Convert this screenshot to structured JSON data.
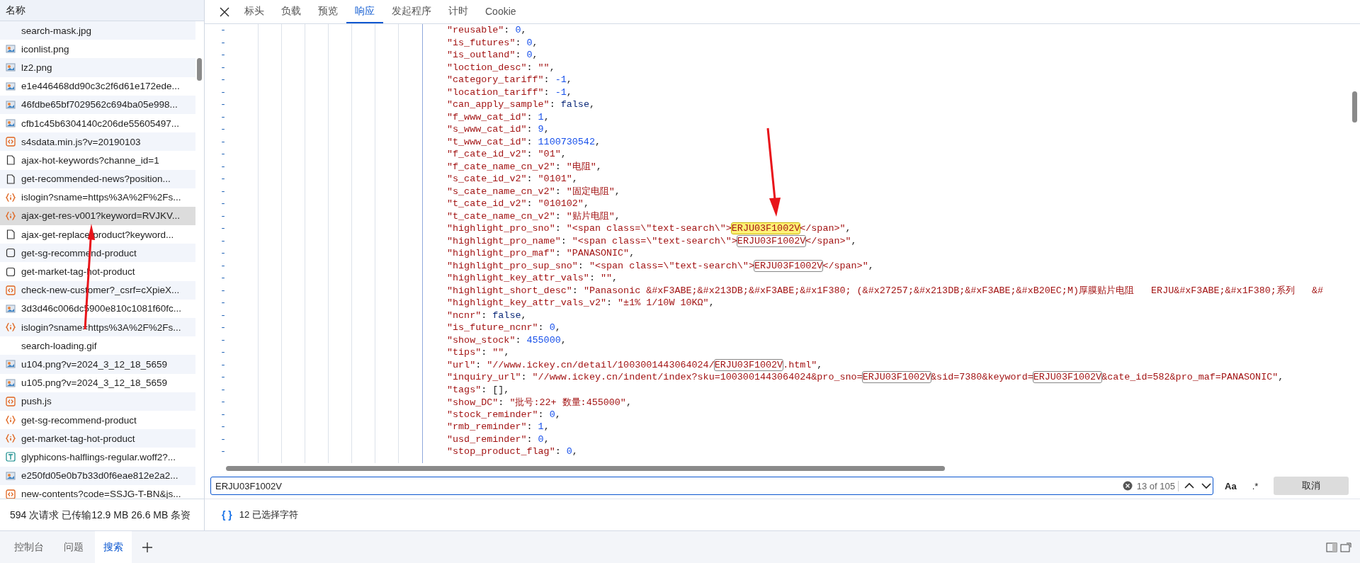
{
  "request_list": {
    "header": "名称",
    "items": [
      {
        "name": "search-mask.jpg",
        "kind": "none",
        "selected": false
      },
      {
        "name": "iconlist.png",
        "kind": "image",
        "selected": false
      },
      {
        "name": "lz2.png",
        "kind": "image",
        "selected": false
      },
      {
        "name": "e1e446468dd90c3c2f6d61e172ede...",
        "kind": "image",
        "selected": false
      },
      {
        "name": "46fdbe65bf7029562c694ba05e998...",
        "kind": "image",
        "selected": false
      },
      {
        "name": "cfb1c45b6304140c206de55605497...",
        "kind": "image",
        "selected": false
      },
      {
        "name": "s4sdata.min.js?v=20190103",
        "kind": "script",
        "selected": false
      },
      {
        "name": "ajax-hot-keywords?channe_id=1",
        "kind": "doc",
        "selected": false
      },
      {
        "name": "get-recommended-news?position...",
        "kind": "doc",
        "selected": false
      },
      {
        "name": "islogin?sname=https%3A%2F%2Fs...",
        "kind": "fetch",
        "selected": false
      },
      {
        "name": "ajax-get-res-v001?keyword=RVJKV...",
        "kind": "fetch",
        "selected": true
      },
      {
        "name": "ajax-get-replace-product?keyword...",
        "kind": "doc",
        "selected": false
      },
      {
        "name": "get-sg-recommend-product",
        "kind": "other",
        "selected": false
      },
      {
        "name": "get-market-tag-hot-product",
        "kind": "other",
        "selected": false
      },
      {
        "name": "check-new-customer?_csrf=cXpieX...",
        "kind": "script",
        "selected": false
      },
      {
        "name": "3d3d46c006dc5900e810c1081f60fc...",
        "kind": "image",
        "selected": false
      },
      {
        "name": "islogin?sname=https%3A%2F%2Fs...",
        "kind": "fetch",
        "selected": false
      },
      {
        "name": "search-loading.gif",
        "kind": "none",
        "selected": false
      },
      {
        "name": "u104.png?v=2024_3_12_18_5659",
        "kind": "image",
        "selected": false
      },
      {
        "name": "u105.png?v=2024_3_12_18_5659",
        "kind": "image",
        "selected": false
      },
      {
        "name": "push.js",
        "kind": "script",
        "selected": false
      },
      {
        "name": "get-sg-recommend-product",
        "kind": "fetch",
        "selected": false
      },
      {
        "name": "get-market-tag-hot-product",
        "kind": "fetch",
        "selected": false
      },
      {
        "name": "glyphicons-halflings-regular.woff2?...",
        "kind": "font",
        "selected": false
      },
      {
        "name": "e250fd05e0b7b33d0f6eae812e2a2...",
        "kind": "image",
        "selected": false
      },
      {
        "name": "new-contents?code=SSJG-T-BN&js...",
        "kind": "script",
        "selected": false
      }
    ]
  },
  "request_status": "594 次请求  已传输12.9 MB  26.6 MB 条资",
  "detail_tabs": [
    {
      "label": "标头",
      "selected": false
    },
    {
      "label": "负载",
      "selected": false
    },
    {
      "label": "预览",
      "selected": false
    },
    {
      "label": "响应",
      "selected": true
    },
    {
      "label": "发起程序",
      "selected": false
    },
    {
      "label": "计时",
      "selected": false
    },
    {
      "label": "Cookie",
      "selected": false
    }
  ],
  "code_lines": [
    {
      "marker": "-",
      "segments": [
        {
          "text": "\"reusable\"",
          "kind": "key"
        },
        {
          "text": ": ",
          "kind": "p"
        },
        {
          "text": "0",
          "kind": "num"
        },
        {
          "text": ",",
          "kind": "p"
        }
      ]
    },
    {
      "marker": "-",
      "segments": [
        {
          "text": "\"is_futures\"",
          "kind": "key"
        },
        {
          "text": ": ",
          "kind": "p"
        },
        {
          "text": "0",
          "kind": "num"
        },
        {
          "text": ",",
          "kind": "p"
        }
      ]
    },
    {
      "marker": "-",
      "segments": [
        {
          "text": "\"is_outland\"",
          "kind": "key"
        },
        {
          "text": ": ",
          "kind": "p"
        },
        {
          "text": "0",
          "kind": "num"
        },
        {
          "text": ",",
          "kind": "p"
        }
      ]
    },
    {
      "marker": "-",
      "segments": [
        {
          "text": "\"loction_desc\"",
          "kind": "key"
        },
        {
          "text": ": ",
          "kind": "p"
        },
        {
          "text": "\"\"",
          "kind": "str"
        },
        {
          "text": ",",
          "kind": "p"
        }
      ]
    },
    {
      "marker": "-",
      "segments": [
        {
          "text": "\"category_tariff\"",
          "kind": "key"
        },
        {
          "text": ": ",
          "kind": "p"
        },
        {
          "text": "-1",
          "kind": "num"
        },
        {
          "text": ",",
          "kind": "p"
        }
      ]
    },
    {
      "marker": "-",
      "segments": [
        {
          "text": "\"location_tariff\"",
          "kind": "key"
        },
        {
          "text": ": ",
          "kind": "p"
        },
        {
          "text": "-1",
          "kind": "num"
        },
        {
          "text": ",",
          "kind": "p"
        }
      ]
    },
    {
      "marker": "-",
      "segments": [
        {
          "text": "\"can_apply_sample\"",
          "kind": "key"
        },
        {
          "text": ": ",
          "kind": "p"
        },
        {
          "text": "false",
          "kind": "kw"
        },
        {
          "text": ",",
          "kind": "p"
        }
      ]
    },
    {
      "marker": "-",
      "segments": [
        {
          "text": "\"f_www_cat_id\"",
          "kind": "key"
        },
        {
          "text": ": ",
          "kind": "p"
        },
        {
          "text": "1",
          "kind": "num"
        },
        {
          "text": ",",
          "kind": "p"
        }
      ]
    },
    {
      "marker": "-",
      "segments": [
        {
          "text": "\"s_www_cat_id\"",
          "kind": "key"
        },
        {
          "text": ": ",
          "kind": "p"
        },
        {
          "text": "9",
          "kind": "num"
        },
        {
          "text": ",",
          "kind": "p"
        }
      ]
    },
    {
      "marker": "-",
      "segments": [
        {
          "text": "\"t_www_cat_id\"",
          "kind": "key"
        },
        {
          "text": ": ",
          "kind": "p"
        },
        {
          "text": "1100730542",
          "kind": "num"
        },
        {
          "text": ",",
          "kind": "p"
        }
      ]
    },
    {
      "marker": "-",
      "segments": [
        {
          "text": "\"f_cate_id_v2\"",
          "kind": "key"
        },
        {
          "text": ": ",
          "kind": "p"
        },
        {
          "text": "\"01\"",
          "kind": "str"
        },
        {
          "text": ",",
          "kind": "p"
        }
      ]
    },
    {
      "marker": "-",
      "segments": [
        {
          "text": "\"f_cate_name_cn_v2\"",
          "kind": "key"
        },
        {
          "text": ": ",
          "kind": "p"
        },
        {
          "text": "\"电阻\"",
          "kind": "str"
        },
        {
          "text": ",",
          "kind": "p"
        }
      ]
    },
    {
      "marker": "-",
      "segments": [
        {
          "text": "\"s_cate_id_v2\"",
          "kind": "key"
        },
        {
          "text": ": ",
          "kind": "p"
        },
        {
          "text": "\"0101\"",
          "kind": "str"
        },
        {
          "text": ",",
          "kind": "p"
        }
      ]
    },
    {
      "marker": "-",
      "segments": [
        {
          "text": "\"s_cate_name_cn_v2\"",
          "kind": "key"
        },
        {
          "text": ": ",
          "kind": "p"
        },
        {
          "text": "\"固定电阻\"",
          "kind": "str"
        },
        {
          "text": ",",
          "kind": "p"
        }
      ]
    },
    {
      "marker": "-",
      "segments": [
        {
          "text": "\"t_cate_id_v2\"",
          "kind": "key"
        },
        {
          "text": ": ",
          "kind": "p"
        },
        {
          "text": "\"010102\"",
          "kind": "str"
        },
        {
          "text": ",",
          "kind": "p"
        }
      ]
    },
    {
      "marker": "-",
      "segments": [
        {
          "text": "\"t_cate_name_cn_v2\"",
          "kind": "key"
        },
        {
          "text": ": ",
          "kind": "p"
        },
        {
          "text": "\"贴片电阻\"",
          "kind": "str"
        },
        {
          "text": ",",
          "kind": "p"
        }
      ]
    },
    {
      "marker": "-",
      "segments": [
        {
          "text": "\"highlight_pro_sno\"",
          "kind": "key"
        },
        {
          "text": ": ",
          "kind": "p"
        },
        {
          "text": "\"<span class=\\\"text-search\\\">",
          "kind": "str"
        },
        {
          "text": "ERJU03F1002V",
          "kind": "current"
        },
        {
          "text": "</span>\"",
          "kind": "str"
        },
        {
          "text": ",",
          "kind": "p"
        }
      ]
    },
    {
      "marker": "-",
      "segments": [
        {
          "text": "\"highlight_pro_name\"",
          "kind": "key"
        },
        {
          "text": ": ",
          "kind": "p"
        },
        {
          "text": "\"<span class=\\\"text-search\\\">",
          "kind": "str"
        },
        {
          "text": "ERJU03F1002V",
          "kind": "match"
        },
        {
          "text": "</span>\"",
          "kind": "str"
        },
        {
          "text": ",",
          "kind": "p"
        }
      ]
    },
    {
      "marker": "-",
      "segments": [
        {
          "text": "\"highlight_pro_maf\"",
          "kind": "key"
        },
        {
          "text": ": ",
          "kind": "p"
        },
        {
          "text": "\"PANASONIC\"",
          "kind": "str"
        },
        {
          "text": ",",
          "kind": "p"
        }
      ]
    },
    {
      "marker": "-",
      "segments": [
        {
          "text": "\"highlight_pro_sup_sno\"",
          "kind": "key"
        },
        {
          "text": ": ",
          "kind": "p"
        },
        {
          "text": "\"<span class=\\\"text-search\\\">",
          "kind": "str"
        },
        {
          "text": "ERJU03F1002V",
          "kind": "match"
        },
        {
          "text": "</span>\"",
          "kind": "str"
        },
        {
          "text": ",",
          "kind": "p"
        }
      ]
    },
    {
      "marker": "-",
      "segments": [
        {
          "text": "\"highlight_key_attr_vals\"",
          "kind": "key"
        },
        {
          "text": ": ",
          "kind": "p"
        },
        {
          "text": "\"\"",
          "kind": "str"
        },
        {
          "text": ",",
          "kind": "p"
        }
      ]
    },
    {
      "marker": "-",
      "segments": [
        {
          "text": "\"highlight_short_desc\"",
          "kind": "key"
        },
        {
          "text": ": ",
          "kind": "p"
        },
        {
          "text": "\"Panasonic &#xF3ABE;&#x213DB;&#xF3ABE;&#x1F380; (&#x27257;&#x213DB;&#xF3ABE;&#xB20EC;M)厚膜贴片电阻   ERJU&#xF3ABE;&#x1F380;系列   &#",
          "kind": "str"
        }
      ]
    },
    {
      "marker": "-",
      "segments": [
        {
          "text": "\"highlight_key_attr_vals_v2\"",
          "kind": "key"
        },
        {
          "text": ": ",
          "kind": "p"
        },
        {
          "text": "\"±1% 1/10W 10KΩ\"",
          "kind": "str"
        },
        {
          "text": ",",
          "kind": "p"
        }
      ]
    },
    {
      "marker": "-",
      "segments": [
        {
          "text": "\"ncnr\"",
          "kind": "key"
        },
        {
          "text": ": ",
          "kind": "p"
        },
        {
          "text": "false",
          "kind": "kw"
        },
        {
          "text": ",",
          "kind": "p"
        }
      ]
    },
    {
      "marker": "-",
      "segments": [
        {
          "text": "\"is_future_ncnr\"",
          "kind": "key"
        },
        {
          "text": ": ",
          "kind": "p"
        },
        {
          "text": "0",
          "kind": "num"
        },
        {
          "text": ",",
          "kind": "p"
        }
      ]
    },
    {
      "marker": "-",
      "segments": [
        {
          "text": "\"show_stock\"",
          "kind": "key"
        },
        {
          "text": ": ",
          "kind": "p"
        },
        {
          "text": "455000",
          "kind": "num"
        },
        {
          "text": ",",
          "kind": "p"
        }
      ]
    },
    {
      "marker": "-",
      "segments": [
        {
          "text": "\"tips\"",
          "kind": "key"
        },
        {
          "text": ": ",
          "kind": "p"
        },
        {
          "text": "\"\"",
          "kind": "str"
        },
        {
          "text": ",",
          "kind": "p"
        }
      ]
    },
    {
      "marker": "-",
      "segments": [
        {
          "text": "\"url\"",
          "kind": "key"
        },
        {
          "text": ": ",
          "kind": "p"
        },
        {
          "text": "\"//www.ickey.cn/detail/1003001443064024/",
          "kind": "str"
        },
        {
          "text": "ERJU03F1002V",
          "kind": "match"
        },
        {
          "text": ".html\"",
          "kind": "str"
        },
        {
          "text": ",",
          "kind": "p"
        }
      ]
    },
    {
      "marker": "-",
      "segments": [
        {
          "text": "\"inquiry_url\"",
          "kind": "key"
        },
        {
          "text": ": ",
          "kind": "p"
        },
        {
          "text": "\"//www.ickey.cn/indent/index?sku=1003001443064024&pro_sno=",
          "kind": "str"
        },
        {
          "text": "ERJU03F1002V",
          "kind": "match"
        },
        {
          "text": "&sid=7380&keyword=",
          "kind": "str"
        },
        {
          "text": "ERJU03F1002V",
          "kind": "match"
        },
        {
          "text": "&cate_id=582&pro_maf=PANASONIC\"",
          "kind": "str"
        },
        {
          "text": ",",
          "kind": "p"
        }
      ]
    },
    {
      "marker": "-",
      "segments": [
        {
          "text": "\"tags\"",
          "kind": "key"
        },
        {
          "text": ": [],",
          "kind": "p"
        }
      ]
    },
    {
      "marker": "-",
      "segments": [
        {
          "text": "\"show_DC\"",
          "kind": "key"
        },
        {
          "text": ": ",
          "kind": "p"
        },
        {
          "text": "\"批号:22+ 数量:455000\"",
          "kind": "str"
        },
        {
          "text": ",",
          "kind": "p"
        }
      ]
    },
    {
      "marker": "-",
      "segments": [
        {
          "text": "\"stock_reminder\"",
          "kind": "key"
        },
        {
          "text": ": ",
          "kind": "p"
        },
        {
          "text": "0",
          "kind": "num"
        },
        {
          "text": ",",
          "kind": "p"
        }
      ]
    },
    {
      "marker": "-",
      "segments": [
        {
          "text": "\"rmb_reminder\"",
          "kind": "key"
        },
        {
          "text": ": ",
          "kind": "p"
        },
        {
          "text": "1",
          "kind": "num"
        },
        {
          "text": ",",
          "kind": "p"
        }
      ]
    },
    {
      "marker": "-",
      "segments": [
        {
          "text": "\"usd_reminder\"",
          "kind": "key"
        },
        {
          "text": ": ",
          "kind": "p"
        },
        {
          "text": "0",
          "kind": "num"
        },
        {
          "text": ",",
          "kind": "p"
        }
      ]
    },
    {
      "marker": "-",
      "segments": [
        {
          "text": "\"stop_product_flag\"",
          "kind": "key"
        },
        {
          "text": ": ",
          "kind": "p"
        },
        {
          "text": "0",
          "kind": "num"
        },
        {
          "text": ",",
          "kind": "p"
        }
      ]
    }
  ],
  "search": {
    "value": "ERJU03F1002V",
    "count": "13 of 105",
    "match_case": "Aa",
    "regex": ".*",
    "cancel": "取消"
  },
  "selection": {
    "icon": "{ }",
    "info": "12 已选择字符"
  },
  "drawer_tabs": [
    {
      "label": "控制台",
      "selected": false
    },
    {
      "label": "问题",
      "selected": false
    },
    {
      "label": "搜索",
      "selected": true
    }
  ]
}
